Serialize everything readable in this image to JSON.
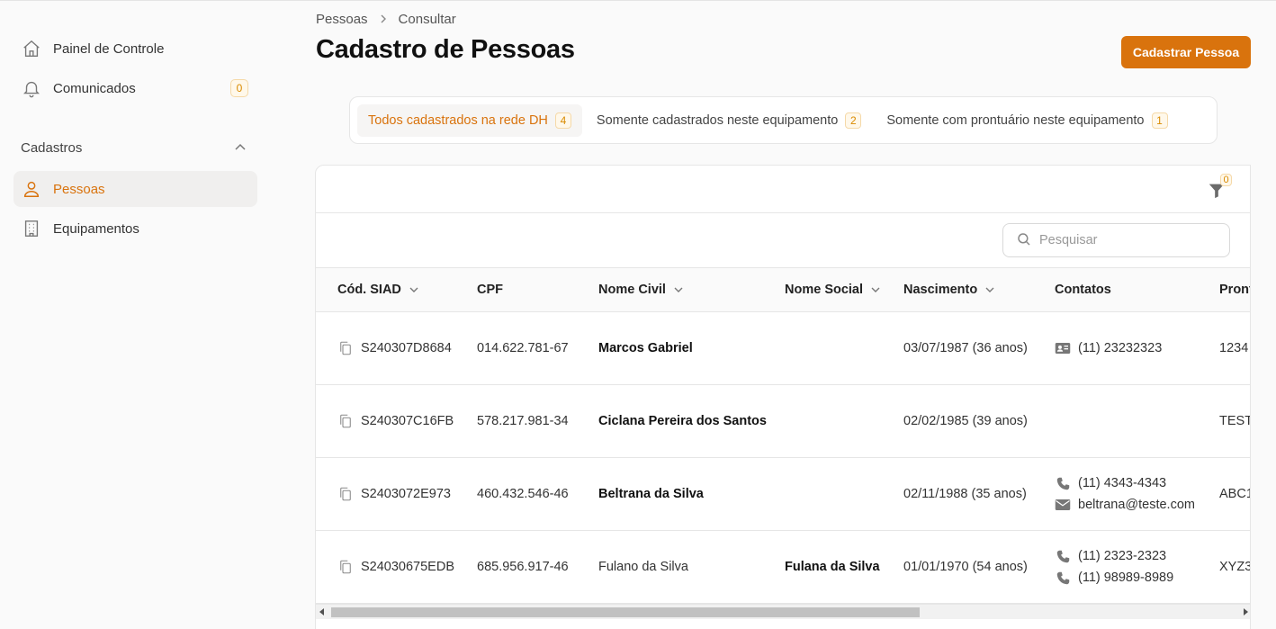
{
  "sidebar": {
    "items": [
      {
        "label": "Painel de Controle",
        "icon": "home-icon"
      },
      {
        "label": "Comunicados",
        "icon": "bell-icon",
        "badge": "0"
      }
    ],
    "section_title": "Cadastros",
    "section_items": [
      {
        "label": "Pessoas",
        "icon": "user-icon",
        "active": true
      },
      {
        "label": "Equipamentos",
        "icon": "building-icon"
      }
    ]
  },
  "breadcrumb": {
    "items": [
      "Pessoas",
      "Consultar"
    ],
    "separator": ">"
  },
  "page": {
    "title": "Cadastro de Pessoas",
    "primary_action": "Cadastrar Pessoa"
  },
  "tabs": [
    {
      "label": "Todos cadastrados na rede DH",
      "count": "4",
      "active": true
    },
    {
      "label": "Somente cadastrados neste equipamento",
      "count": "2"
    },
    {
      "label": "Somente com prontuário neste equipamento",
      "count": "1"
    }
  ],
  "filter": {
    "count": "0"
  },
  "search": {
    "placeholder": "Pesquisar",
    "value": ""
  },
  "table": {
    "columns": [
      {
        "label": "Cód. SIAD",
        "sortable": true
      },
      {
        "label": "CPF",
        "sortable": false
      },
      {
        "label": "Nome Civil",
        "sortable": true
      },
      {
        "label": "Nome Social",
        "sortable": true
      },
      {
        "label": "Nascimento",
        "sortable": true
      },
      {
        "label": "Contatos",
        "sortable": false
      },
      {
        "label": "Pront",
        "sortable": false
      }
    ],
    "rows": [
      {
        "siad": "S240307D8684",
        "cpf": "014.622.781-67",
        "nome_civil": "Marcos Gabriel",
        "nome_civil_bold": true,
        "nome_social": "",
        "nascimento": "03/07/1987 (36 anos)",
        "contatos": [
          {
            "icon": "id-card-icon",
            "text": "(11) 23232323"
          }
        ],
        "prontuario": "1234"
      },
      {
        "siad": "S240307C16FB",
        "cpf": "578.217.981-34",
        "nome_civil": "Ciclana Pereira dos Santos",
        "nome_civil_bold": true,
        "nome_social": "",
        "nascimento": "02/02/1985 (39 anos)",
        "contatos": [],
        "prontuario": "TEST"
      },
      {
        "siad": "S2403072E973",
        "cpf": "460.432.546-46",
        "nome_civil": "Beltrana da Silva",
        "nome_civil_bold": true,
        "nome_social": "",
        "nascimento": "02/11/1988 (35 anos)",
        "contatos": [
          {
            "icon": "phone-icon",
            "text": "(11) 4343-4343"
          },
          {
            "icon": "mail-icon",
            "text": "beltrana@teste.com"
          }
        ],
        "prontuario": "ABC1"
      },
      {
        "siad": "S24030675EDB",
        "cpf": "685.956.917-46",
        "nome_civil": "Fulano da Silva",
        "nome_civil_bold": false,
        "nome_social": "Fulana da Silva",
        "nascimento": "01/01/1970 (54 anos)",
        "contatos": [
          {
            "icon": "phone-icon",
            "text": "(11) 2323-2323"
          },
          {
            "icon": "phone-icon",
            "text": "(11) 98989-8989"
          }
        ],
        "prontuario": "XYZ3"
      }
    ]
  },
  "colors": {
    "accent": "#d9730d",
    "badge_text": "#d98a00",
    "badge_bg": "#fff8ea",
    "badge_border": "#f5d9a8"
  }
}
